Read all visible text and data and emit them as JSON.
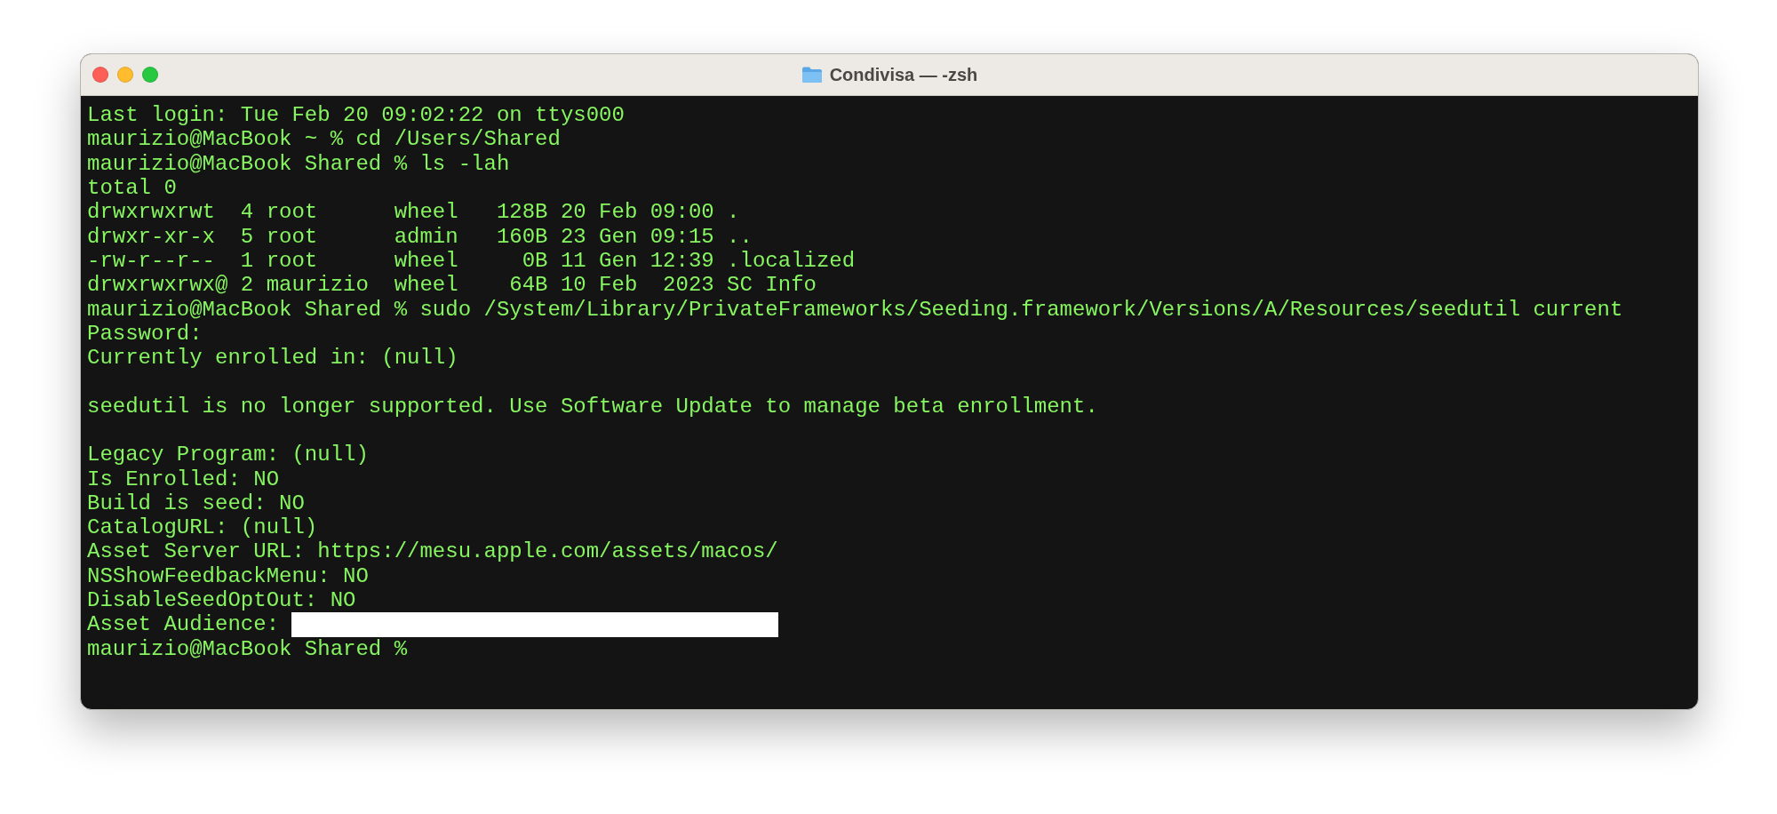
{
  "window": {
    "title": "Condivisa — -zsh"
  },
  "terminal": {
    "lines": [
      {
        "kind": "text",
        "text": "Last login: Tue Feb 20 09:02:22 on ttys000"
      },
      {
        "kind": "text",
        "text": "maurizio@MacBook ~ % cd /Users/Shared"
      },
      {
        "kind": "text",
        "text": "maurizio@MacBook Shared % ls -lah"
      },
      {
        "kind": "text",
        "text": "total 0"
      },
      {
        "kind": "text",
        "text": "drwxrwxrwt  4 root      wheel   128B 20 Feb 09:00 ."
      },
      {
        "kind": "text",
        "text": "drwxr-xr-x  5 root      admin   160B 23 Gen 09:15 .."
      },
      {
        "kind": "text",
        "text": "-rw-r--r--  1 root      wheel     0B 11 Gen 12:39 .localized"
      },
      {
        "kind": "text",
        "text": "drwxrwxrwx@ 2 maurizio  wheel    64B 10 Feb  2023 SC Info"
      },
      {
        "kind": "text",
        "text": "maurizio@MacBook Shared % sudo /System/Library/PrivateFrameworks/Seeding.framework/Versions/A/Resources/seedutil current"
      },
      {
        "kind": "text",
        "text": "Password:"
      },
      {
        "kind": "text",
        "text": "Currently enrolled in: (null)"
      },
      {
        "kind": "blank"
      },
      {
        "kind": "text",
        "text": "seedutil is no longer supported. Use Software Update to manage beta enrollment."
      },
      {
        "kind": "blank"
      },
      {
        "kind": "text",
        "text": "Legacy Program: (null)"
      },
      {
        "kind": "text",
        "text": "Is Enrolled: NO"
      },
      {
        "kind": "text",
        "text": "Build is seed: NO"
      },
      {
        "kind": "text",
        "text": "CatalogURL: (null)"
      },
      {
        "kind": "text",
        "text": "Asset Server URL: https://mesu.apple.com/assets/macos/"
      },
      {
        "kind": "text",
        "text": "NSShowFeedbackMenu: NO"
      },
      {
        "kind": "text",
        "text": "DisableSeedOptOut: NO"
      },
      {
        "kind": "redacted",
        "text": "Asset Audience: "
      },
      {
        "kind": "text",
        "text": "maurizio@MacBook Shared %"
      }
    ]
  }
}
